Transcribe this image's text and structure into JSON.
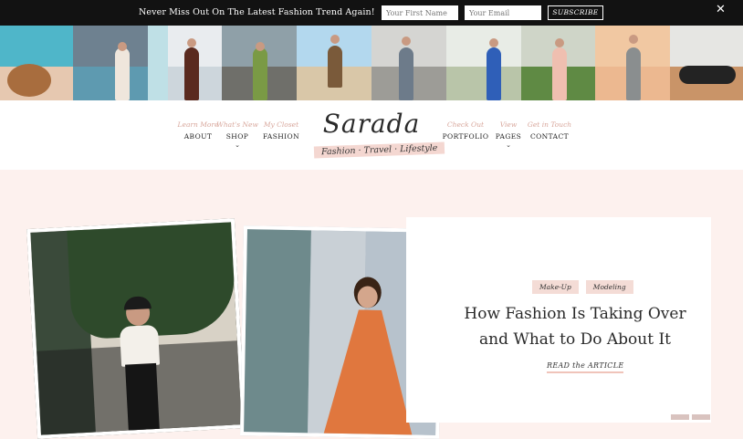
{
  "topbar": {
    "message": "Never Miss Out On The Latest Fashion Trend Again!",
    "first_name_placeholder": "Your First Name",
    "email_placeholder": "Your Email",
    "subscribe_label": "SUBSCRIBE",
    "close_icon": "close-icon"
  },
  "nav": {
    "items_left": [
      {
        "sub": "Learn More",
        "label": "ABOUT"
      },
      {
        "sub": "What's New",
        "label": "SHOP"
      },
      {
        "sub": "My Closet",
        "label": "FASHION"
      }
    ],
    "items_right": [
      {
        "sub": "Check Out",
        "label": "PORTFOLIO"
      },
      {
        "sub": "View",
        "label": "PAGES"
      },
      {
        "sub": "Get in Touch",
        "label": "CONTACT"
      }
    ],
    "logo_name": "Sarada",
    "logo_tagline": "Fashion · Travel · Lifestyle"
  },
  "featured": {
    "tags": [
      "Make-Up",
      "Modeling"
    ],
    "title_line1": "How Fashion Is Taking Over",
    "title_line2": "and What to Do About It",
    "read_label": "READ the ARTICLE"
  },
  "colors": {
    "accent": "#f4d7d1",
    "background": "#fdf1ee",
    "topbar": "#121212"
  }
}
